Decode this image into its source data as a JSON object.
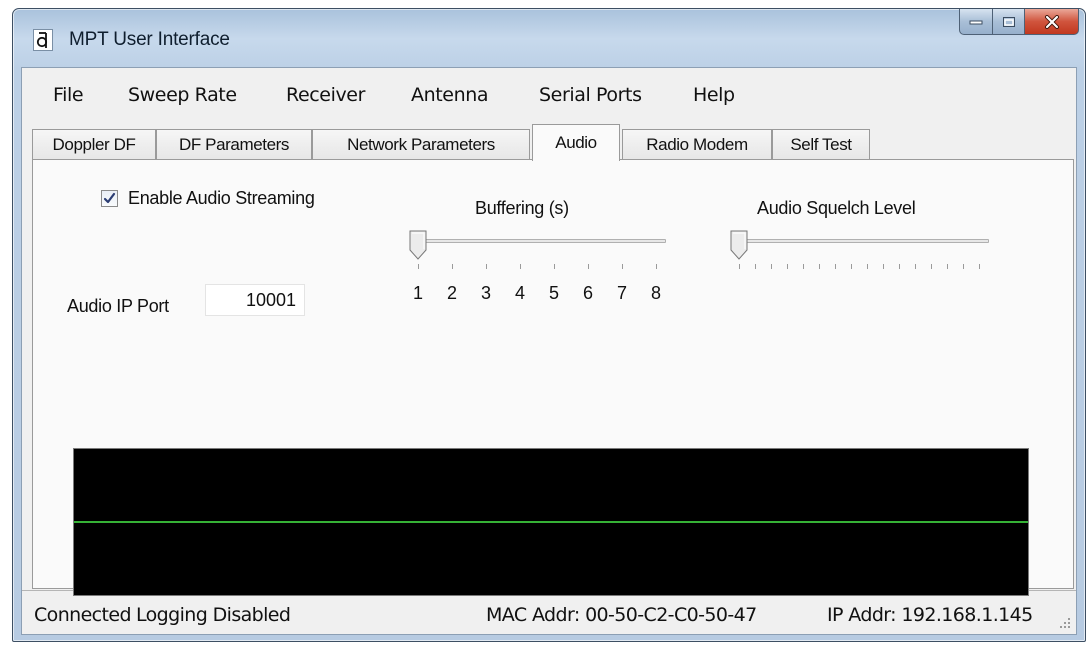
{
  "window": {
    "title": "MPT User Interface",
    "app_icon": "mpt-logo-icon",
    "controls": {
      "minimize_icon": "minimize-icon",
      "maximize_icon": "maximize-icon",
      "close_icon": "close-icon"
    }
  },
  "menu": {
    "items": [
      "File",
      "Sweep Rate",
      "Receiver",
      "Antenna",
      "Serial Ports",
      "Help"
    ]
  },
  "tabs": {
    "items": [
      "Doppler DF",
      "DF Parameters",
      "Network Parameters",
      "Audio",
      "Radio Modem",
      "Self Test"
    ],
    "active": "Audio"
  },
  "audio": {
    "enable_streaming": {
      "label": "Enable Audio Streaming",
      "checked": true
    },
    "ip_port": {
      "label": "Audio IP Port",
      "value": "10001"
    },
    "buffering": {
      "title": "Buffering (s)",
      "value": 1,
      "scale": [
        "1",
        "2",
        "3",
        "4",
        "5",
        "6",
        "7",
        "8"
      ]
    },
    "squelch": {
      "title": "Audio Squelch Level",
      "level": 0
    },
    "scope": {
      "trace_color": "#36b236",
      "background": "#000000"
    }
  },
  "status": {
    "connection": "Connected",
    "logging": "Logging Disabled",
    "mac": "MAC Addr: 00-50-C2-C0-50-47",
    "ip": "IP Addr: 192.168.1.145"
  },
  "colors": {
    "accent_close": "#c1381f",
    "panel_bg": "#f0f0f0"
  }
}
